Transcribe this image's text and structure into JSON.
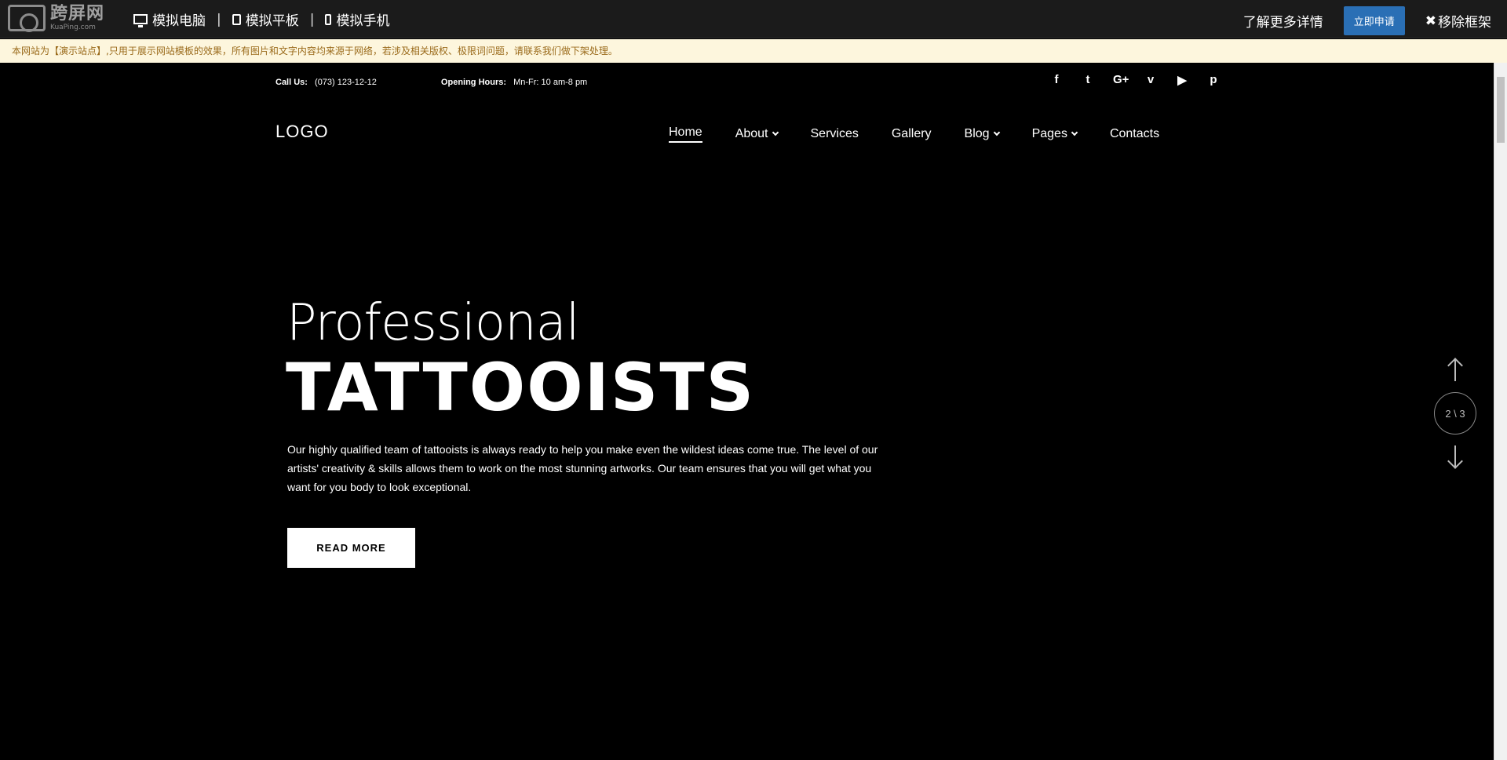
{
  "demo_bar": {
    "logo_cn": "跨屏网",
    "logo_en": "KuaPing.com",
    "devices": [
      {
        "label": "模拟电脑",
        "icon": "desktop-icon"
      },
      {
        "label": "模拟平板",
        "icon": "tablet-icon"
      },
      {
        "label": "模拟手机",
        "icon": "phone-icon"
      }
    ],
    "separator": "|",
    "more_info": "了解更多详情",
    "apply": "立即申请",
    "remove_frame": "移除框架",
    "remove_icon": "✖"
  },
  "notice": "本网站为【演示站点】,只用于展示网站模板的效果，所有图片和文字内容均来源于网络，若涉及相关版权、极限词问题，请联系我们做下架处理。",
  "topbar": {
    "call_label": "Call Us:",
    "call_value": "(073) 123-12-12",
    "hours_label": "Opening Hours:",
    "hours_value": "Mn-Fr: 10 am-8 pm",
    "socials": [
      {
        "name": "facebook-icon",
        "glyph": "f"
      },
      {
        "name": "twitter-icon",
        "glyph": "t"
      },
      {
        "name": "google-plus-icon",
        "glyph": "G+"
      },
      {
        "name": "vimeo-icon",
        "glyph": "v"
      },
      {
        "name": "youtube-icon",
        "glyph": "▶"
      },
      {
        "name": "pinterest-icon",
        "glyph": "p"
      }
    ]
  },
  "header": {
    "logo": "LOGO",
    "nav": [
      {
        "label": "Home",
        "active": true
      },
      {
        "label": "About",
        "dropdown": true
      },
      {
        "label": "Services"
      },
      {
        "label": "Gallery"
      },
      {
        "label": "Blog",
        "dropdown": true
      },
      {
        "label": "Pages",
        "dropdown": true
      },
      {
        "label": "Contacts"
      }
    ]
  },
  "hero": {
    "pre_title": "Professional",
    "title": "TATTOOISTS",
    "text": "Our highly qualified team of tattooists is always ready to help you make even the wildest ideas come true. The level of our artists' creativity & skills allows them to work on the most stunning artworks. Our team ensures that you will get what you want for you body to look exceptional.",
    "button": "READ MORE"
  },
  "slider": {
    "counter": "2 \\ 3"
  }
}
